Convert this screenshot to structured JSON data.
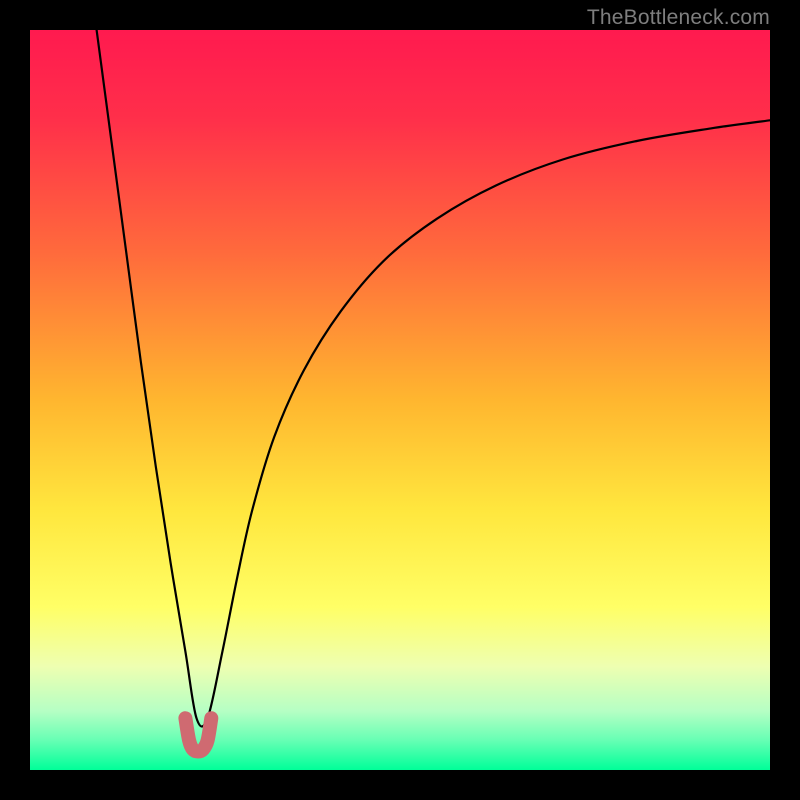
{
  "watermark": "TheBottleneck.com",
  "colors": {
    "frame": "#000000",
    "curve": "#000000",
    "marker": "#cf6a71",
    "gradient_stops": [
      {
        "offset": 0.0,
        "color": "#ff1a4f"
      },
      {
        "offset": 0.12,
        "color": "#ff2f4a"
      },
      {
        "offset": 0.3,
        "color": "#ff6a3c"
      },
      {
        "offset": 0.5,
        "color": "#ffb62f"
      },
      {
        "offset": 0.65,
        "color": "#ffe73e"
      },
      {
        "offset": 0.78,
        "color": "#ffff66"
      },
      {
        "offset": 0.86,
        "color": "#eeffb1"
      },
      {
        "offset": 0.92,
        "color": "#b6ffc4"
      },
      {
        "offset": 0.96,
        "color": "#66ffb4"
      },
      {
        "offset": 1.0,
        "color": "#00ff99"
      }
    ]
  },
  "chart_data": {
    "type": "line",
    "title": "",
    "xlabel": "",
    "ylabel": "",
    "xlim": [
      0,
      100
    ],
    "ylim": [
      0,
      100
    ],
    "grid": false,
    "legend": false,
    "series": [
      {
        "name": "bottleneck-curve",
        "x": [
          9,
          11,
          13,
          15,
          17,
          19,
          21,
          22.5,
          24,
          26,
          28,
          30,
          33,
          37,
          42,
          48,
          55,
          63,
          72,
          82,
          92,
          100
        ],
        "y": [
          100,
          85,
          70,
          55,
          41,
          28,
          16,
          7,
          7,
          16,
          26,
          35,
          45,
          54,
          62,
          69,
          74.5,
          79,
          82.5,
          85,
          86.7,
          87.8
        ]
      },
      {
        "name": "optimum-marker",
        "x": [
          21,
          21.5,
          22,
          22.7,
          23.4,
          24,
          24.5
        ],
        "y": [
          7,
          4,
          2.8,
          2.5,
          2.8,
          4,
          7
        ]
      }
    ],
    "annotations": []
  }
}
